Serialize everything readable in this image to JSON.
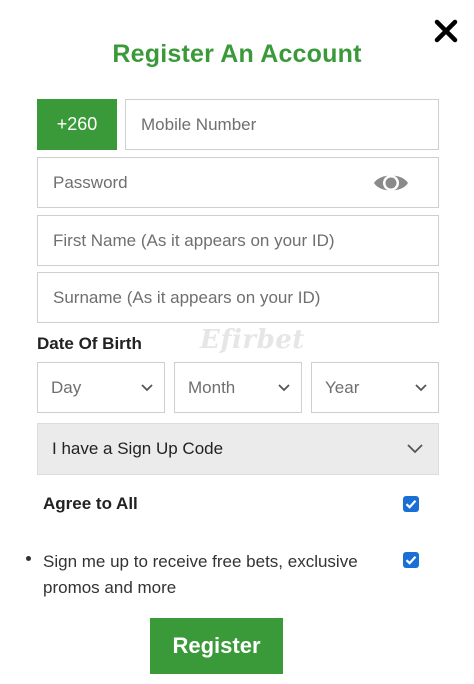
{
  "title": "Register An Account",
  "close_icon": "close-icon",
  "phone": {
    "country_code": "+260",
    "placeholder": "Mobile Number"
  },
  "password": {
    "placeholder": "Password",
    "toggle_icon": "eye-icon"
  },
  "first_name": {
    "placeholder": "First Name (As it appears on your ID)"
  },
  "surname": {
    "placeholder": "Surname (As it appears on your ID)"
  },
  "dob": {
    "label": "Date Of Birth",
    "day": "Day",
    "month": "Month",
    "year": "Year"
  },
  "watermark": "Efirbet",
  "signup_code": {
    "label": "I have a Sign Up Code"
  },
  "agree_all": {
    "label": "Agree to All",
    "checked": true
  },
  "promo": {
    "label": "Sign me up to receive free bets, exclusive promos and more",
    "checked": true
  },
  "register_button": "Register",
  "colors": {
    "brand_green": "#3a9a3a",
    "checkbox_blue": "#1a6fd6",
    "input_border": "#cfcfcf",
    "code_bg": "#ebebeb"
  }
}
